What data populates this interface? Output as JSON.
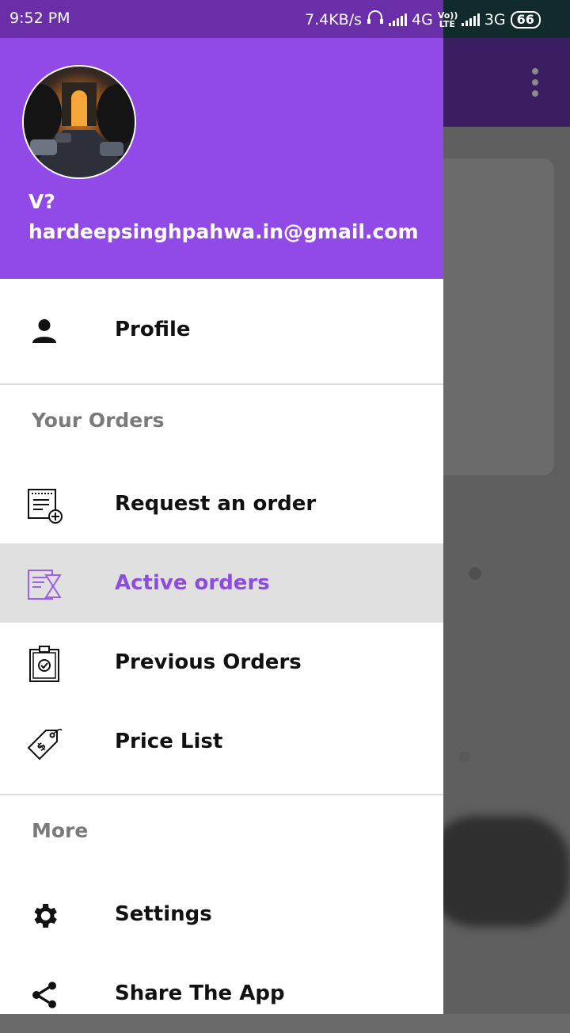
{
  "status_bar": {
    "time": "9:52 PM",
    "speed": "7.4KB/s",
    "network1": "4G",
    "volte": "Vo)) LTE",
    "network2": "3G",
    "battery": "66"
  },
  "drawer": {
    "user_name": "V?",
    "user_email": "hardeepsinghpahwa.in@gmail.com",
    "profile_label": "Profile",
    "section_orders": "Your Orders",
    "request_label": "Request an order",
    "active_label": "Active orders",
    "previous_label": "Previous Orders",
    "price_label": "Price List",
    "section_more": "More",
    "settings_label": "Settings",
    "share_label": "Share The App"
  },
  "colors": {
    "header": "#9149e8",
    "active_text": "#8e4be0",
    "status_bar": "#6a2fa8"
  }
}
